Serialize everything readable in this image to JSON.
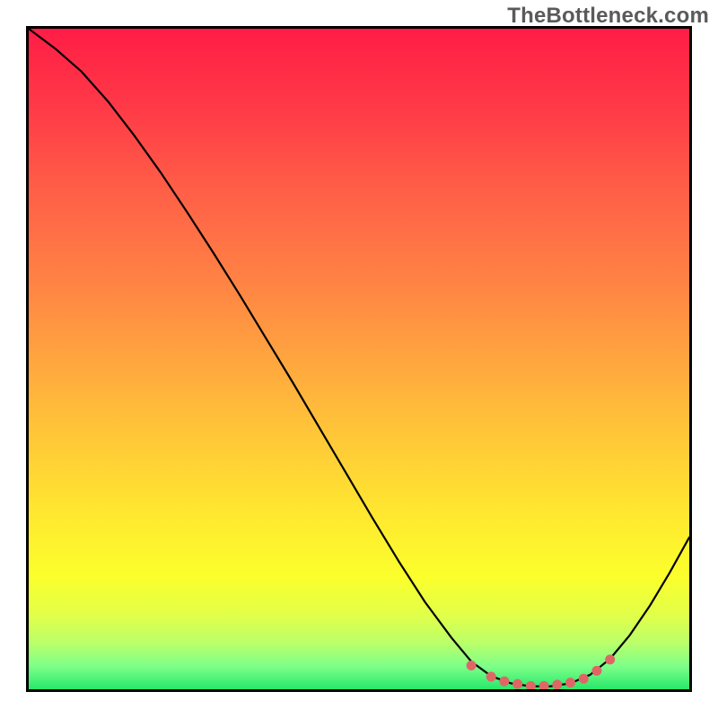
{
  "watermark": "TheBottleneck.com",
  "chart_data": {
    "type": "line",
    "title": "",
    "xlabel": "",
    "ylabel": "",
    "xlim": [
      0,
      100
    ],
    "ylim": [
      0,
      100
    ],
    "grid": false,
    "legend": false,
    "series": [
      {
        "name": "bottleneck-curve",
        "x": [
          0,
          4,
          8,
          12,
          16,
          20,
          24,
          28,
          32,
          36,
          40,
          44,
          48,
          52,
          56,
          60,
          64,
          67,
          70,
          73,
          76,
          79,
          82,
          85,
          88,
          91,
          94,
          97,
          100
        ],
        "y": [
          100,
          97,
          93.5,
          89,
          83.8,
          78.2,
          72.2,
          66,
          59.6,
          53,
          46.4,
          39.6,
          32.8,
          26,
          19.4,
          13.2,
          7.8,
          4.2,
          2,
          0.9,
          0.45,
          0.45,
          0.9,
          2.2,
          4.6,
          8.2,
          12.6,
          17.6,
          23
        ]
      }
    ],
    "markers": {
      "name": "highlight-dots",
      "x": [
        67,
        70,
        72,
        74,
        76,
        78,
        80,
        82,
        84,
        86,
        88
      ],
      "y": [
        3.6,
        1.9,
        1.2,
        0.8,
        0.5,
        0.5,
        0.7,
        1.0,
        1.6,
        2.8,
        4.5
      ]
    },
    "background_gradient": {
      "stops": [
        {
          "offset": 0.0,
          "color": "#ff1d46"
        },
        {
          "offset": 0.12,
          "color": "#ff3a47"
        },
        {
          "offset": 0.25,
          "color": "#ff6047"
        },
        {
          "offset": 0.38,
          "color": "#ff8244"
        },
        {
          "offset": 0.5,
          "color": "#ffa53f"
        },
        {
          "offset": 0.62,
          "color": "#ffc838"
        },
        {
          "offset": 0.74,
          "color": "#ffe92f"
        },
        {
          "offset": 0.83,
          "color": "#fbff2c"
        },
        {
          "offset": 0.89,
          "color": "#e0ff4a"
        },
        {
          "offset": 0.93,
          "color": "#baff6a"
        },
        {
          "offset": 0.965,
          "color": "#7eff89"
        },
        {
          "offset": 1.0,
          "color": "#27e86a"
        }
      ]
    }
  }
}
